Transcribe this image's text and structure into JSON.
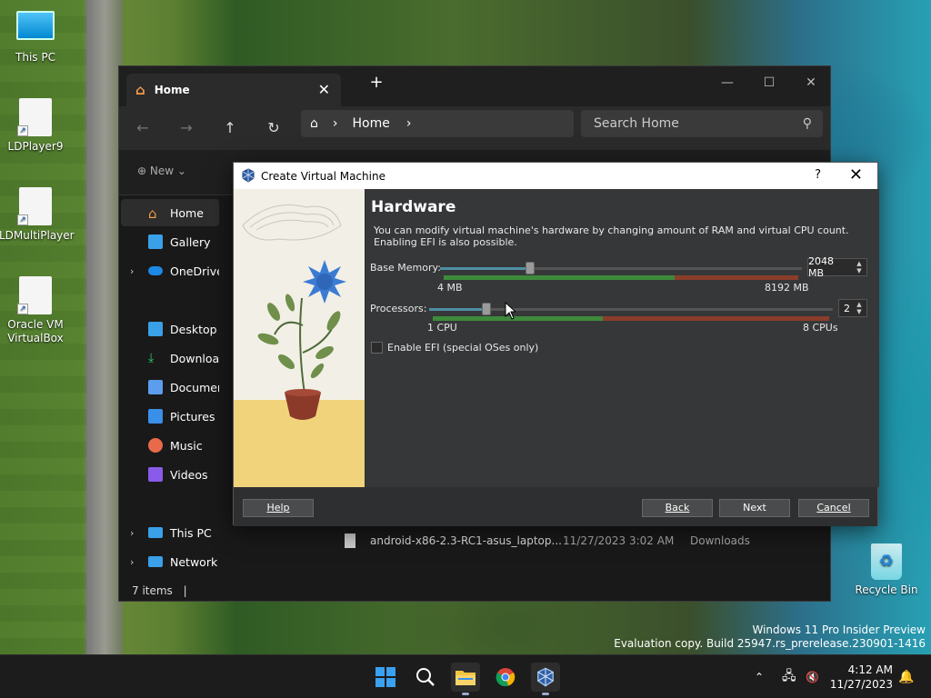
{
  "desktop": {
    "icons": [
      {
        "label": "This PC"
      },
      {
        "label": "LDPlayer9"
      },
      {
        "label": "LDMultiPlayer"
      },
      {
        "label": "Oracle VM VirtualBox"
      },
      {
        "label": "Recycle Bin"
      }
    ],
    "watermark_line1": "Windows 11 Pro Insider Preview",
    "watermark_line2": "Evaluation copy. Build 25947.rs_prerelease.230901-1416"
  },
  "taskbar": {
    "time": "4:12 AM",
    "date": "11/27/2023",
    "pinned": [
      "start-icon",
      "search-icon",
      "file-explorer-icon",
      "chrome-icon",
      "virtualbox-icon"
    ]
  },
  "explorer": {
    "tab_title": "Home",
    "breadcrumb": "Home",
    "search_placeholder": "Search Home",
    "new_label": "New",
    "sidebar": [
      {
        "label": "Home",
        "icon": "home-icon",
        "color": "#f39c4a"
      },
      {
        "label": "Gallery",
        "icon": "gallery-icon",
        "color": "#3aa0e8"
      },
      {
        "label": "OneDrive",
        "icon": "cloud-icon",
        "color": "#1e88e5"
      },
      {
        "label": "Desktop",
        "icon": "desktop-icon",
        "color": "#3aa0e8"
      },
      {
        "label": "Downloads",
        "icon": "download-icon",
        "color": "#2ecc71"
      },
      {
        "label": "Documents",
        "icon": "documents-icon",
        "color": "#5c9ded"
      },
      {
        "label": "Pictures",
        "icon": "pictures-icon",
        "color": "#3a8fe8"
      },
      {
        "label": "Music",
        "icon": "music-icon",
        "color": "#e86a4a"
      },
      {
        "label": "Videos",
        "icon": "videos-icon",
        "color": "#8a5ae8"
      },
      {
        "label": "This PC",
        "icon": "pc-icon",
        "color": "#3aa0e8"
      },
      {
        "label": "Network",
        "icon": "network-icon",
        "color": "#3aa0e8"
      }
    ],
    "file": {
      "name": "android-x86-2.3-RC1-asus_laptop...",
      "modified": "11/27/2023 3:02 AM",
      "location": "Downloads"
    },
    "status": "7 items"
  },
  "dialog": {
    "title": "Create Virtual Machine",
    "help_glyph": "?",
    "heading": "Hardware",
    "description": "You can modify virtual machine's hardware by changing amount of RAM and virtual CPU count. Enabling EFI is also possible.",
    "memory": {
      "label": "Base Memory:",
      "value": 2048,
      "value_text": "2048 MB",
      "min_label": "4 MB",
      "max_label": "8192 MB",
      "min": 4,
      "max": 8192
    },
    "processors": {
      "label": "Processors:",
      "value": 2,
      "value_text": "2",
      "min_label": "1 CPU",
      "max_label": "8 CPUs",
      "min": 1,
      "max": 8
    },
    "efi": {
      "label": "Enable EFI (special OSes only)",
      "checked": false
    },
    "buttons": {
      "help": "Help",
      "back": "Back",
      "next": "Next",
      "cancel": "Cancel"
    }
  }
}
